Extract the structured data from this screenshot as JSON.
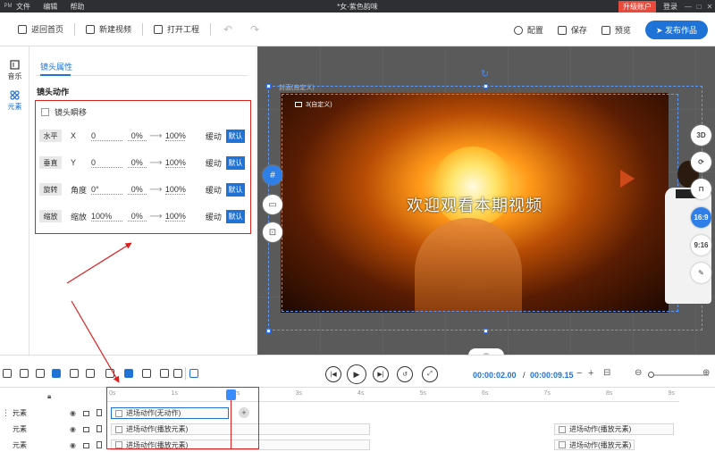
{
  "titlebar": {
    "logo": "PM",
    "menu": [
      "文件",
      "编辑",
      "帮助"
    ],
    "title": "*女-紫色韵味",
    "upgrade": "升级账户",
    "login": "登录",
    "win_controls": [
      "—",
      "□",
      "✕"
    ]
  },
  "toolbar": {
    "home": "返回首页",
    "new_video": "新建视频",
    "open_project": "打开工程",
    "config": "配置",
    "save": "保存",
    "preview": "预览",
    "publish": "发布作品"
  },
  "leftnav": {
    "items": [
      {
        "label": "音乐",
        "icon": "music-icon"
      },
      {
        "label": "元素",
        "icon": "element-icon"
      }
    ]
  },
  "props": {
    "tab": "镜头属性",
    "section_title": "镜头动作",
    "cut_label": "镜头瞬移",
    "rows": [
      {
        "tag": "水平",
        "axis": "X",
        "value": "0",
        "from": "0%",
        "to": "100%",
        "easing": "缓动",
        "default": "默认"
      },
      {
        "tag": "垂直",
        "axis": "Y",
        "value": "0",
        "from": "0%",
        "to": "100%",
        "easing": "缓动",
        "default": "默认"
      },
      {
        "tag": "旋转",
        "axis": "角度",
        "value": "0°",
        "from": "0%",
        "to": "100%",
        "easing": "缓动",
        "default": "默认"
      },
      {
        "tag": "缩放",
        "axis": "缩放",
        "value": "100%",
        "from": "0%",
        "to": "100%",
        "easing": "缓动",
        "default": "默认"
      }
    ]
  },
  "stage": {
    "caption": "欢迎观看本期视频",
    "scene_label": "3(自定义)",
    "selection_label": "封面(自定义)",
    "ratio_buttons": [
      "3D",
      "16:9",
      "9:16"
    ],
    "collapse_glyph": "︽"
  },
  "playback": {
    "current_time": "00:00:02.00",
    "separator": "/",
    "total_time": "00:00:09.15",
    "zoom_minus": "−",
    "zoom_plus": "+"
  },
  "timeline": {
    "ticks": [
      "0s",
      "1s",
      "2s",
      "3s",
      "4s",
      "5s",
      "6s",
      "7s",
      "8s",
      "9s"
    ],
    "tracks": [
      {
        "name": "元素"
      },
      {
        "name": "元素"
      },
      {
        "name": "元素"
      }
    ],
    "clips": {
      "t1_a": "进场动作(无动作)",
      "t2_a": "进场动作(播放元素)",
      "t2_b": "进场动作(播放元素)",
      "t3_a": "进场动作(播放元素)",
      "t3_b": "进场动作(播放元素)"
    },
    "add": "+"
  }
}
